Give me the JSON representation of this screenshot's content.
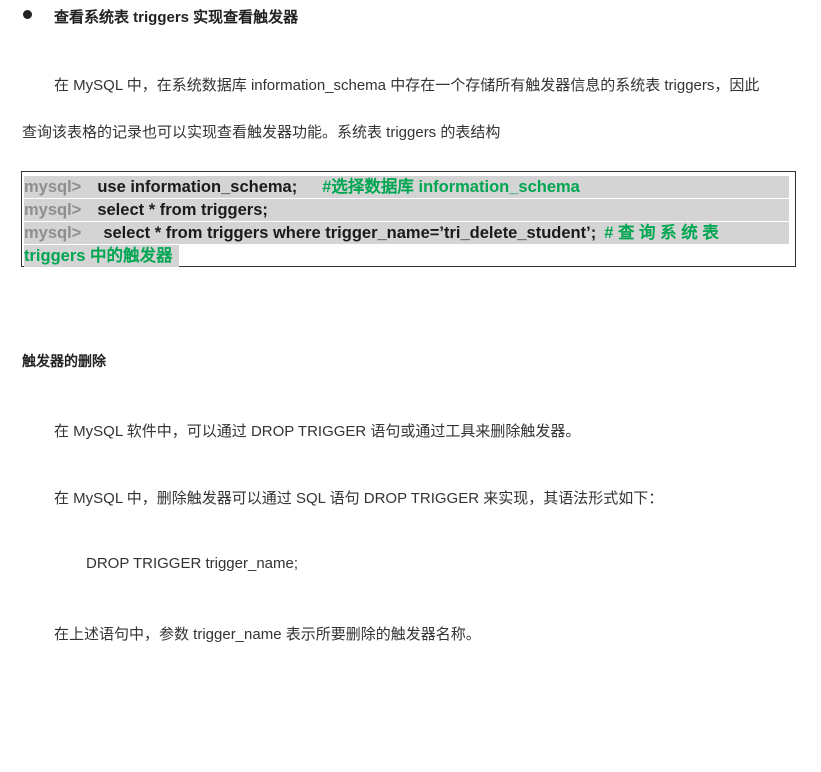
{
  "heading": "查看系统表 triggers 实现查看触发器",
  "intro_line1": "在 MySQL 中，在系统数据库 information_schema 中存在一个存储所有触发器信息的系统表 triggers，因此",
  "intro_line2": "查询该表格的记录也可以实现查看触发器功能。系统表 triggers 的表结构",
  "code": {
    "prompt": "mysql>",
    "line1_cmd": "use information_schema;",
    "line1_comment": "#选择数据库 information_schema",
    "line2_cmd": "select * from triggers;",
    "line3_cmd": "select  *  from  triggers  where  trigger_name=’tri_delete_student’;",
    "line3_comment": "# 查 询 系 统 表",
    "line4_comment": "triggers 中的触发器"
  },
  "section_title": "触发器的删除",
  "para1": "在 MySQL 软件中，可以通过 DROP TRIGGER 语句或通过工具来删除触发器。",
  "para2": "在 MySQL 中，删除触发器可以通过 SQL 语句 DROP TRIGGER 来实现，其语法形式如下：",
  "syntax": "DROP TRIGGER trigger_name;",
  "para3": "在上述语句中，参数 trigger_name 表示所要删除的触发器名称。"
}
